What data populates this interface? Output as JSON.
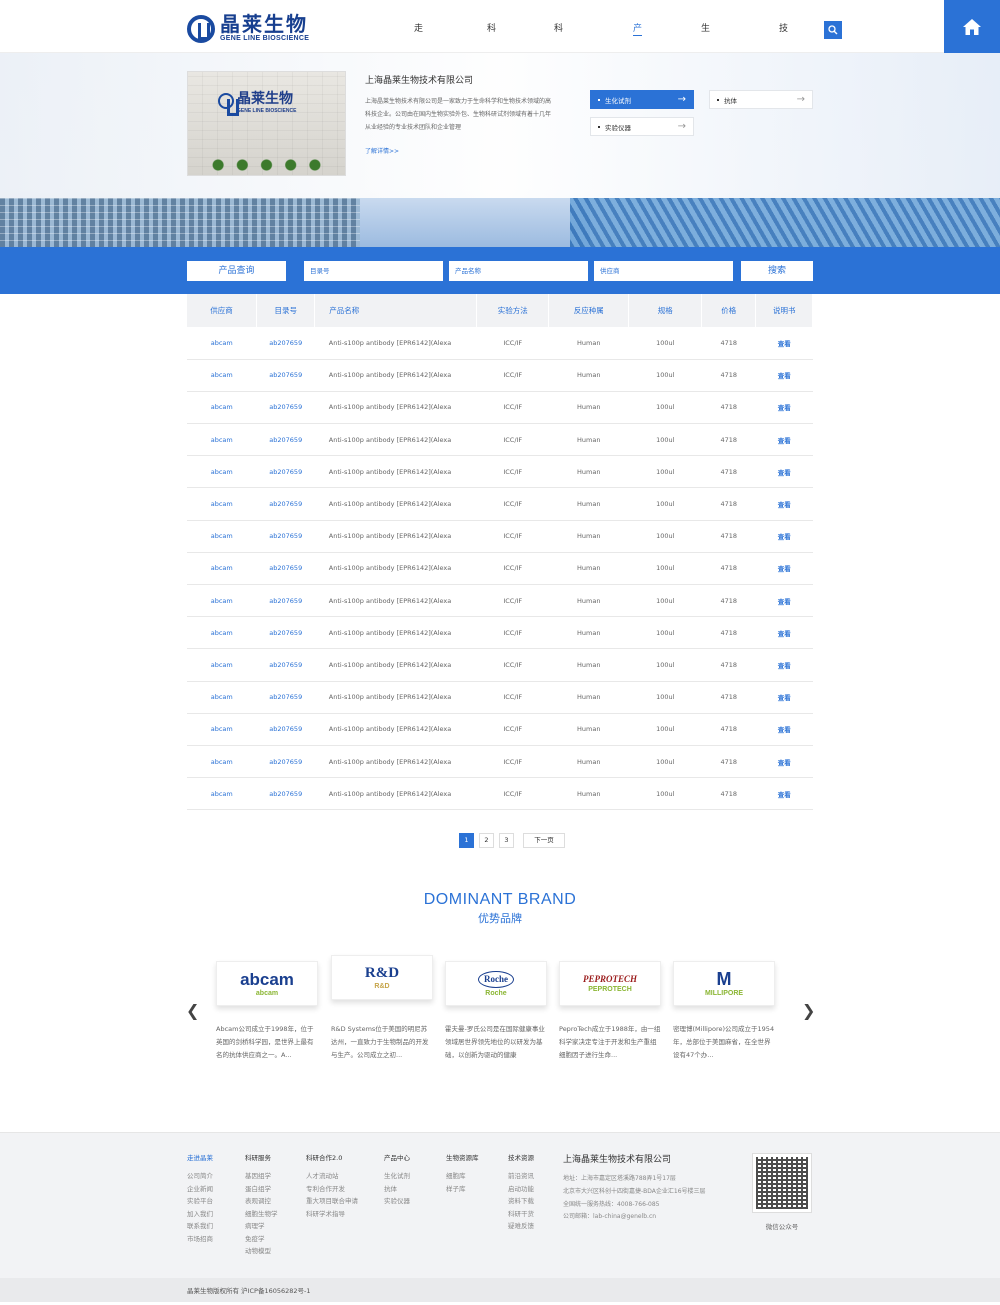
{
  "header": {
    "logo_cn": "晶莱生物",
    "logo_en": "GENE LINE BIOSCIENCE",
    "nav": [
      {
        "label": "走进晶莱",
        "active": false
      },
      {
        "label": "科研服务",
        "active": false
      },
      {
        "label": "科研合作2.0",
        "active": false
      },
      {
        "label": "产品中心",
        "active": true
      },
      {
        "label": "生物资源库",
        "active": false
      },
      {
        "label": "技术资源",
        "active": false
      }
    ]
  },
  "banner": {
    "company_name": "上海晶莱生物技术有限公司",
    "company_desc": "上海晶莱生物技术有限公司是一家致力于生命科学和生物技术领域的高科技企业。公司由在国内生物实验外包、生物科研试剂领域有着十几年从业经验的专业技术团队和企业管理",
    "more_link": "了解详情>>",
    "image_brand_cn": "晶莱生物",
    "image_brand_en": "GENE LINE BIOSCIENCE",
    "categories": [
      {
        "label": "生化试剂",
        "active": true
      },
      {
        "label": "抗体",
        "active": false
      },
      {
        "label": "实验仪器",
        "active": false
      }
    ]
  },
  "search": {
    "label": "产品查询",
    "catalog_placeholder": "目录号",
    "name_placeholder": "产品名称",
    "supplier_placeholder": "供应商",
    "button": "搜索"
  },
  "table": {
    "headers": [
      "供应商",
      "目录号",
      "产品名称",
      "实验方法",
      "反应种属",
      "规格",
      "价格",
      "说明书"
    ],
    "rows": [
      [
        "abcam",
        "ab207659",
        "Anti-s100p antibody [EPR6142](Alexa",
        "ICC/IF",
        "Human",
        "100ul",
        "4718",
        "查看"
      ],
      [
        "abcam",
        "ab207659",
        "Anti-s100p antibody [EPR6142](Alexa",
        "ICC/IF",
        "Human",
        "100ul",
        "4718",
        "查看"
      ],
      [
        "abcam",
        "ab207659",
        "Anti-s100p antibody [EPR6142](Alexa",
        "ICC/IF",
        "Human",
        "100ul",
        "4718",
        "查看"
      ],
      [
        "abcam",
        "ab207659",
        "Anti-s100p antibody [EPR6142](Alexa",
        "ICC/IF",
        "Human",
        "100ul",
        "4718",
        "查看"
      ],
      [
        "abcam",
        "ab207659",
        "Anti-s100p antibody [EPR6142](Alexa",
        "ICC/IF",
        "Human",
        "100ul",
        "4718",
        "查看"
      ],
      [
        "abcam",
        "ab207659",
        "Anti-s100p antibody [EPR6142](Alexa",
        "ICC/IF",
        "Human",
        "100ul",
        "4718",
        "查看"
      ],
      [
        "abcam",
        "ab207659",
        "Anti-s100p antibody [EPR6142](Alexa",
        "ICC/IF",
        "Human",
        "100ul",
        "4718",
        "查看"
      ],
      [
        "abcam",
        "ab207659",
        "Anti-s100p antibody [EPR6142](Alexa",
        "ICC/IF",
        "Human",
        "100ul",
        "4718",
        "查看"
      ],
      [
        "abcam",
        "ab207659",
        "Anti-s100p antibody [EPR6142](Alexa",
        "ICC/IF",
        "Human",
        "100ul",
        "4718",
        "查看"
      ],
      [
        "abcam",
        "ab207659",
        "Anti-s100p antibody [EPR6142](Alexa",
        "ICC/IF",
        "Human",
        "100ul",
        "4718",
        "查看"
      ],
      [
        "abcam",
        "ab207659",
        "Anti-s100p antibody [EPR6142](Alexa",
        "ICC/IF",
        "Human",
        "100ul",
        "4718",
        "查看"
      ],
      [
        "abcam",
        "ab207659",
        "Anti-s100p antibody [EPR6142](Alexa",
        "ICC/IF",
        "Human",
        "100ul",
        "4718",
        "查看"
      ],
      [
        "abcam",
        "ab207659",
        "Anti-s100p antibody [EPR6142](Alexa",
        "ICC/IF",
        "Human",
        "100ul",
        "4718",
        "查看"
      ],
      [
        "abcam",
        "ab207659",
        "Anti-s100p antibody [EPR6142](Alexa",
        "ICC/IF",
        "Human",
        "100ul",
        "4718",
        "查看"
      ],
      [
        "abcam",
        "ab207659",
        "Anti-s100p antibody [EPR6142](Alexa",
        "ICC/IF",
        "Human",
        "100ul",
        "4718",
        "查看"
      ]
    ]
  },
  "pagination": {
    "pages": [
      "1",
      "2",
      "3"
    ],
    "active": "1",
    "next": "下一页"
  },
  "brands": {
    "title_en": "DOMINANT BRAND",
    "title_cn": "优势品牌",
    "items": [
      {
        "name": "abcam",
        "sub": "abcam",
        "desc": "Abcam公司成立于1998年，位于英国的剑桥科学园，是世界上最有名的抗体供应商之一。A..."
      },
      {
        "name": "R&D",
        "sub": "R&D",
        "desc": "R&D Systems位于美国的明尼苏达州，一直致力于生物制品的开发与生产。公司成立之初..."
      },
      {
        "name": "Roche",
        "sub": "Roche",
        "desc": "霍夫曼-罗氏公司是在国际健康事业领域居世界领先地位的以研发为基础，以创新为驱动的健康"
      },
      {
        "name": "PEPROTECH",
        "sub": "PEPROTECH",
        "desc": "PeproTech成立于1988年，由一组科学家决定专注于开发和生产重组细胞因子进行生命..."
      },
      {
        "name": "M",
        "sub": "MILLIPORE",
        "desc": "密理博(Millipore)公司成立于1954年，总部位于美国麻省，在全世界设有47个办..."
      }
    ]
  },
  "footer": {
    "columns": [
      {
        "title": "走进晶莱",
        "items": [
          "公司简介",
          "企业新闻",
          "实验平台",
          "加入我们",
          "联系我们",
          "市场招商"
        ]
      },
      {
        "title": "科研服务",
        "items": [
          "基因组学",
          "蛋白组学",
          "表观调控",
          "细胞生物学",
          "病理学",
          "免疫学",
          "动物模型"
        ]
      },
      {
        "title": "科研合作2.0",
        "items": [
          "人才流动站",
          "专利合作开发",
          "重大项目联合申请",
          "科研学术指导"
        ]
      },
      {
        "title": "产品中心",
        "items": [
          "生化试剂",
          "抗体",
          "实验仪器"
        ]
      },
      {
        "title": "生物资源库",
        "items": [
          "细胞库",
          "样子库"
        ]
      },
      {
        "title": "技术资源",
        "items": [
          "前沿资讯",
          "启动功能",
          "资料下载",
          "科研干货",
          "疑难反馈"
        ]
      }
    ],
    "company": {
      "name": "上海晶莱生物技术有限公司",
      "lines": [
        "地址：上海市嘉定区塔溪路788弄1号17层",
        "北京市大兴区科创十四街嘉捷-BDA企业汇16号楼三层",
        "全国统一服务热线：4008-766-085",
        "公司邮箱：lab-china@genelb.cn"
      ]
    },
    "qr_label": "微信公众号",
    "copyright": "晶莱生物版权所有 沪ICP备16056282号-1"
  },
  "colors": {
    "primary": "#2b72d6",
    "logo": "#173f8f"
  }
}
